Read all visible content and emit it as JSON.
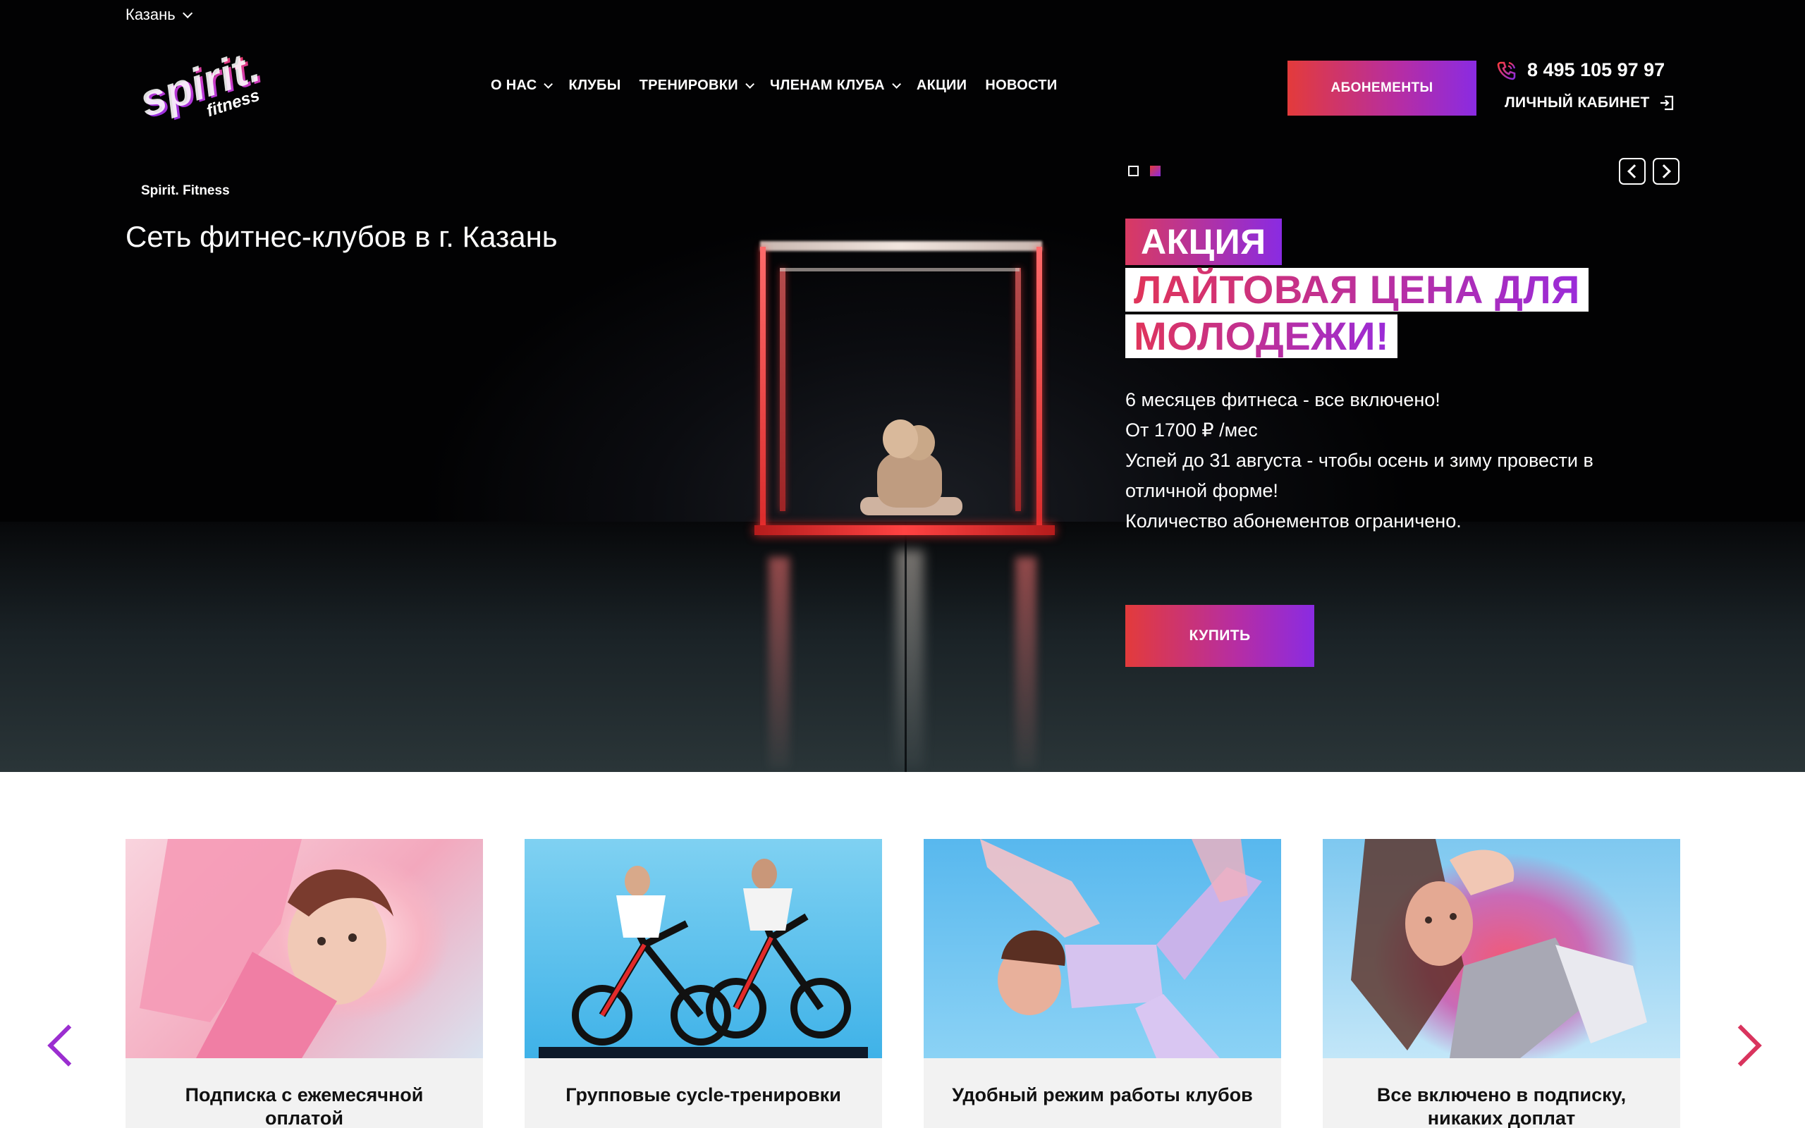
{
  "header": {
    "city": "Казань",
    "nav": [
      {
        "label": "О НАС",
        "dropdown": true
      },
      {
        "label": "КЛУБЫ",
        "dropdown": false
      },
      {
        "label": "ТРЕНИРОВКИ",
        "dropdown": true
      },
      {
        "label": "ЧЛЕНАМ КЛУБА",
        "dropdown": true
      },
      {
        "label": "АКЦИИ",
        "dropdown": false
      },
      {
        "label": "НОВОСТИ",
        "dropdown": false
      }
    ],
    "subscriptions_button": "АБОНЕМЕНТЫ",
    "phone": "8 495 105 97 97",
    "account_link": "ЛИЧНЫЙ КАБИНЕТ"
  },
  "logo": {
    "word1": "spirit.",
    "word2": "fitness"
  },
  "hero": {
    "breadcrumb": "Spirit. Fitness",
    "tagline": "Сеть фитнес-клубов в г. Казань",
    "slide_count": 2,
    "active_slide": 2,
    "promo": {
      "tag": "АКЦИЯ",
      "line1": "ЛАЙТОВАЯ ЦЕНА ДЛЯ",
      "line2": "МОЛОДЕЖИ!",
      "text": [
        "6 месяцев фитнеса - все включено!",
        "От 1700 ₽ /мес",
        "Успей до 31 августа - чтобы осень и зиму провести в отличной форме!",
        "Количество абонементов ограничено."
      ],
      "button": "КУПИТЬ"
    }
  },
  "features": [
    {
      "title": "Подписка с ежемесячной оплатой"
    },
    {
      "title": "Групповые cycle-тренировки"
    },
    {
      "title": "Удобный режим работы клубов"
    },
    {
      "title": "Все включено в подписку, никаких доплат"
    }
  ],
  "colors": {
    "accent_start": "#e33b3b",
    "accent_end": "#8a2be2",
    "hero_bg": "#050608",
    "card_bg": "#f2f2f2"
  }
}
